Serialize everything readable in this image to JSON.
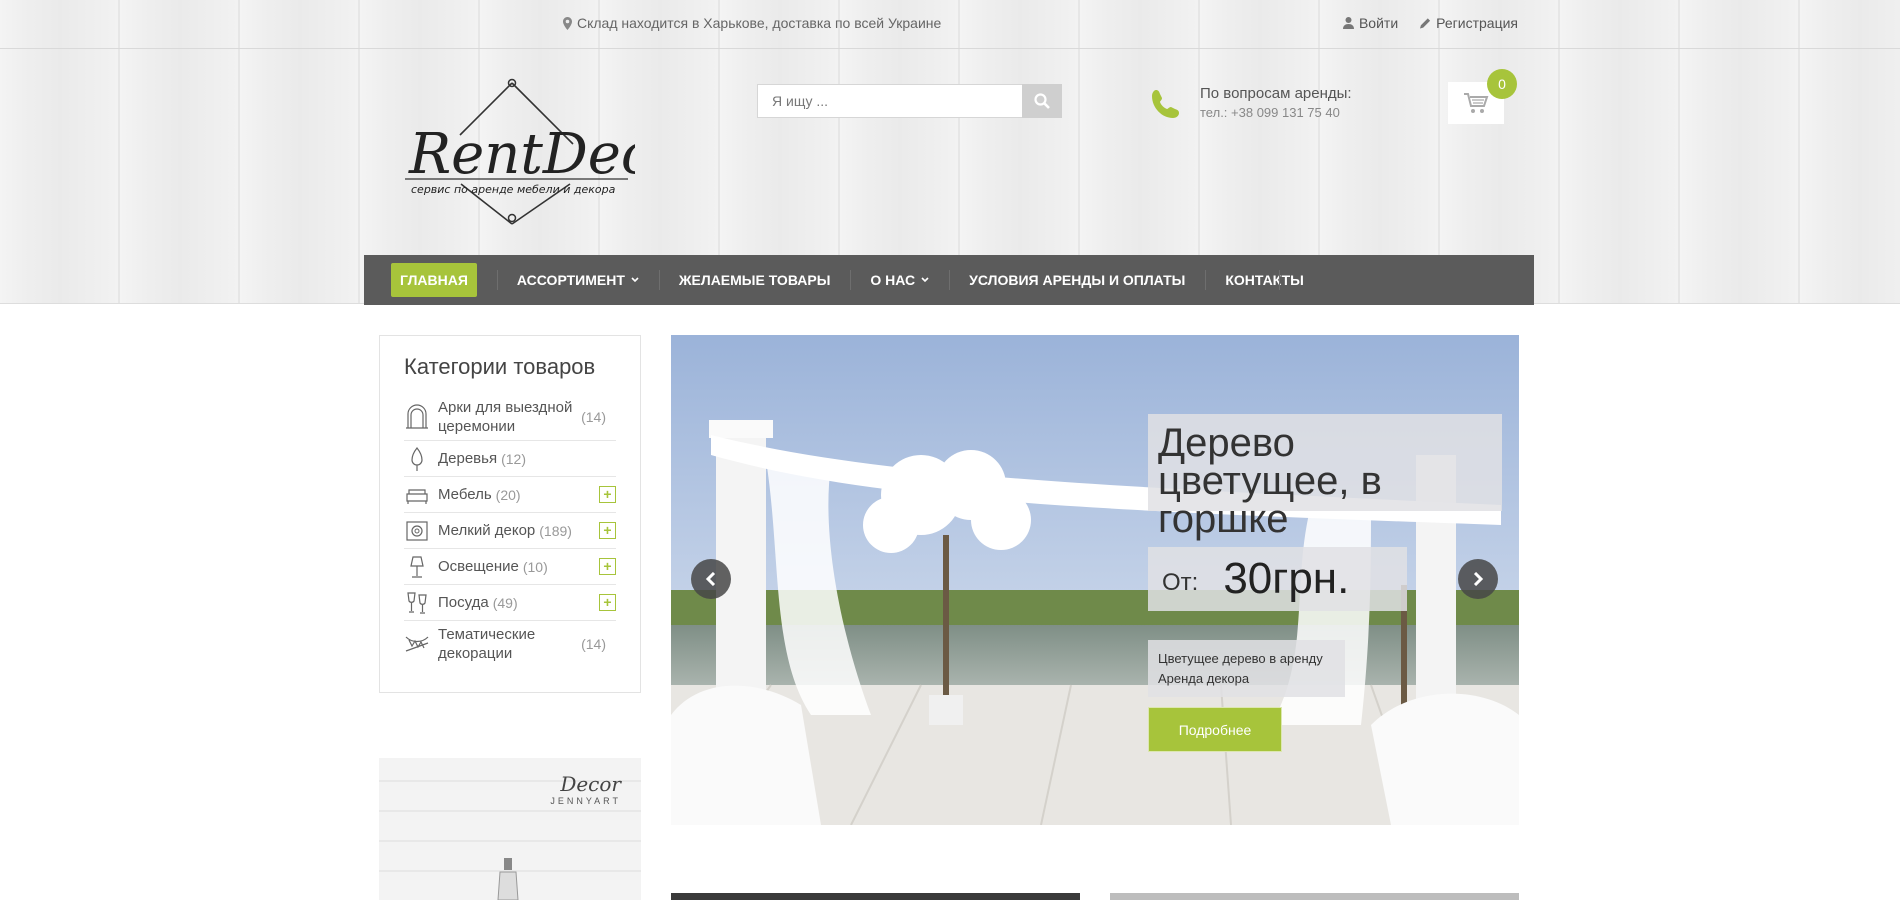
{
  "topbar": {
    "location": "Склад находится в Харькове, доставка по всей Украине",
    "login": "Войти",
    "register": "Регистрация"
  },
  "logo": {
    "name": "RentDeco",
    "tagline": "сервис по аренде мебели и декора"
  },
  "search": {
    "placeholder": "Я ищу ..."
  },
  "contact": {
    "title": "По вопросам аренды:",
    "phone": "тел.: +38 099 131 75 40"
  },
  "cart": {
    "count": "0"
  },
  "nav": {
    "items": [
      {
        "label": "ГЛАВНАЯ"
      },
      {
        "label": "АССОРТИМЕНТ"
      },
      {
        "label": "ЖЕЛАЕМЫЕ ТОВАРЫ"
      },
      {
        "label": "О НАС"
      },
      {
        "label": "УСЛОВИЯ АРЕНДЫ И ОПЛАТЫ"
      },
      {
        "label": "КОНТАКТЫ"
      }
    ]
  },
  "sidebar": {
    "title": "Категории товаров",
    "items": [
      {
        "label": "Арки для выездной церемонии",
        "count": "(14)"
      },
      {
        "label": "Деревья",
        "count": "(12)"
      },
      {
        "label": "Мебель",
        "count": "(20)"
      },
      {
        "label": "Мелкий декор",
        "count": "(189)"
      },
      {
        "label": "Освещение",
        "count": "(10)"
      },
      {
        "label": "Посуда",
        "count": "(49)"
      },
      {
        "label": "Тематические декорации",
        "count": "(14)"
      }
    ]
  },
  "banner": {
    "brand": "Decor",
    "brand_sub": "JENNYART"
  },
  "slider": {
    "title": "Дерево цветущее, в горшке",
    "price_prefix": "От:",
    "price": "30грн.",
    "desc_line1": "Цветущее дерево в аренду",
    "desc_line2": "Аренда декора",
    "button": "Подробнее"
  },
  "colors": {
    "accent": "#a7c43b",
    "nav_bg": "#5b5b5b"
  }
}
